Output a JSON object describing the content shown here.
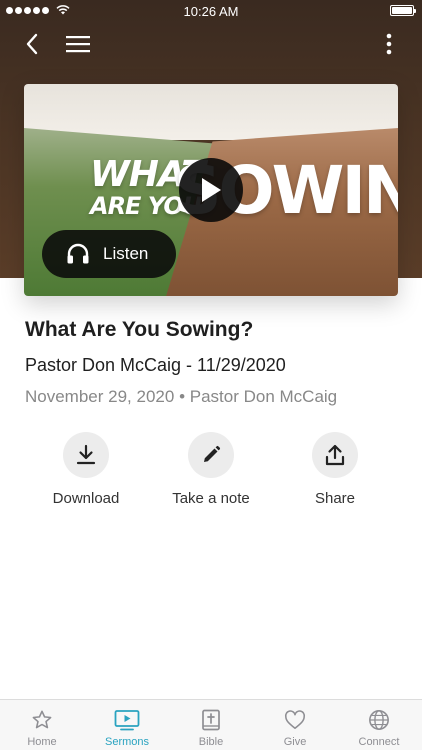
{
  "status_bar": {
    "time": "10:26 AM"
  },
  "sermon": {
    "title": "What Are You Sowing?",
    "subtitle": "Pastor Don McCaig - 11/29/2020",
    "date": "November 29, 2020",
    "speaker": "Pastor Don McCaig",
    "separator": "•",
    "artwork_line1": "WHAT",
    "artwork_line2": "ARE YOU",
    "artwork_big": "SOWING"
  },
  "player": {
    "listen_label": "Listen"
  },
  "actions": {
    "download_label": "Download",
    "note_label": "Take a note",
    "share_label": "Share"
  },
  "tabs": [
    {
      "label": "Home",
      "icon": "star-icon",
      "active": false
    },
    {
      "label": "Sermons",
      "icon": "video-icon",
      "active": true
    },
    {
      "label": "Bible",
      "icon": "bible-icon",
      "active": false
    },
    {
      "label": "Give",
      "icon": "heart-icon",
      "active": false
    },
    {
      "label": "Connect",
      "icon": "globe-icon",
      "active": false
    }
  ],
  "colors": {
    "accent": "#2aa3c0",
    "header": "#4a3424",
    "inactive": "#8e8e93"
  }
}
